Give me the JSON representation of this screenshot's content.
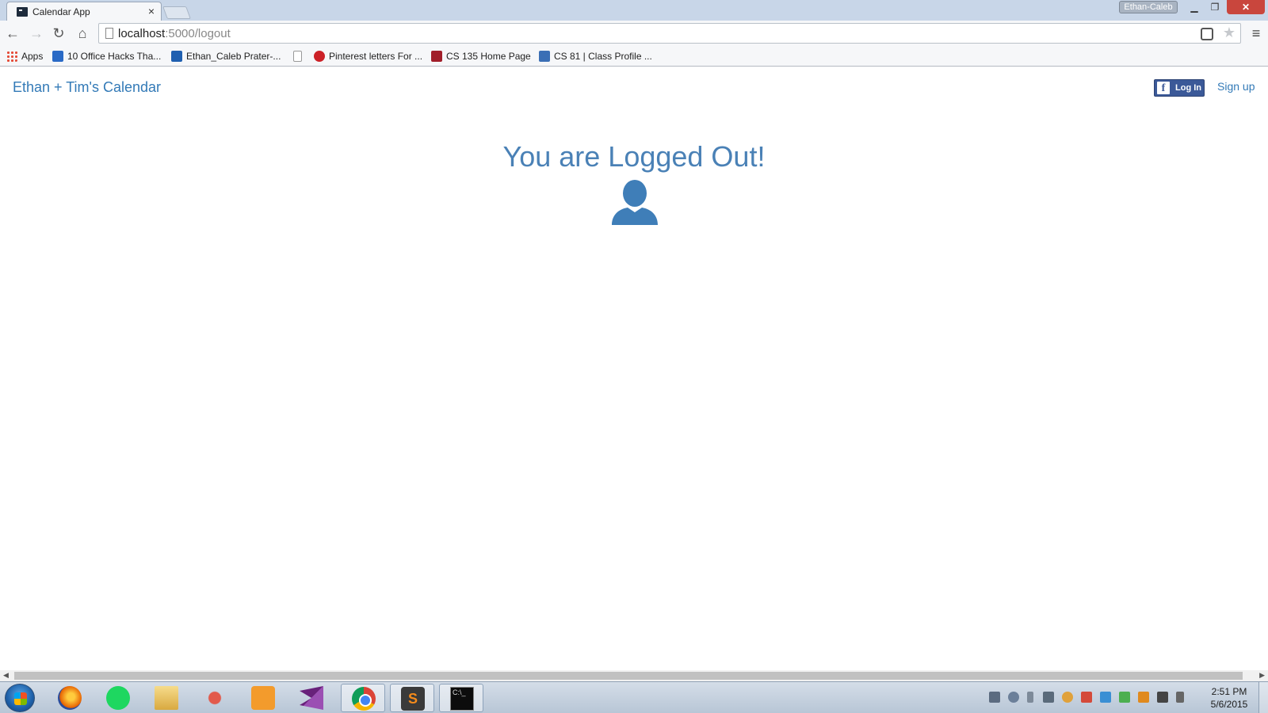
{
  "browser": {
    "tab_title": "Calendar App",
    "tab_close": "×",
    "profile_name": "Ethan-Caleb",
    "url_host": "localhost",
    "url_path": ":5000/logout",
    "bookmarks": [
      {
        "label": "Apps",
        "icon": "apps-grid-icon"
      },
      {
        "label": "10 Office Hacks Tha...",
        "icon": "office-icon"
      },
      {
        "label": "Ethan_Caleb Prater-...",
        "icon": "outlook-icon"
      },
      {
        "label": "",
        "icon": "blank-page-icon"
      },
      {
        "label": "Pinterest letters For ...",
        "icon": "pinterest-icon"
      },
      {
        "label": "CS 135 Home Page",
        "icon": "course-icon"
      },
      {
        "label": "CS 81 | Class Profile ...",
        "icon": "piazza-icon"
      }
    ]
  },
  "page": {
    "brand": "Ethan + Tim's Calendar",
    "fb_login_label": "Log In",
    "signup_label": "Sign up",
    "headline": "You are Logged Out!",
    "accent_color": "#337ab7",
    "fb_color": "#3b5998"
  },
  "taskbar": {
    "apps": [
      "firefox-icon",
      "spotify-icon",
      "file-explorer-icon",
      "git-icon",
      "media-player-icon",
      "visual-studio-icon",
      "chrome-icon",
      "sublime-text-icon",
      "command-prompt-icon"
    ],
    "cmd_text": "C:\\_",
    "sublime_letter": "S",
    "clock_time": "2:51 PM",
    "clock_date": "5/6/2015"
  }
}
